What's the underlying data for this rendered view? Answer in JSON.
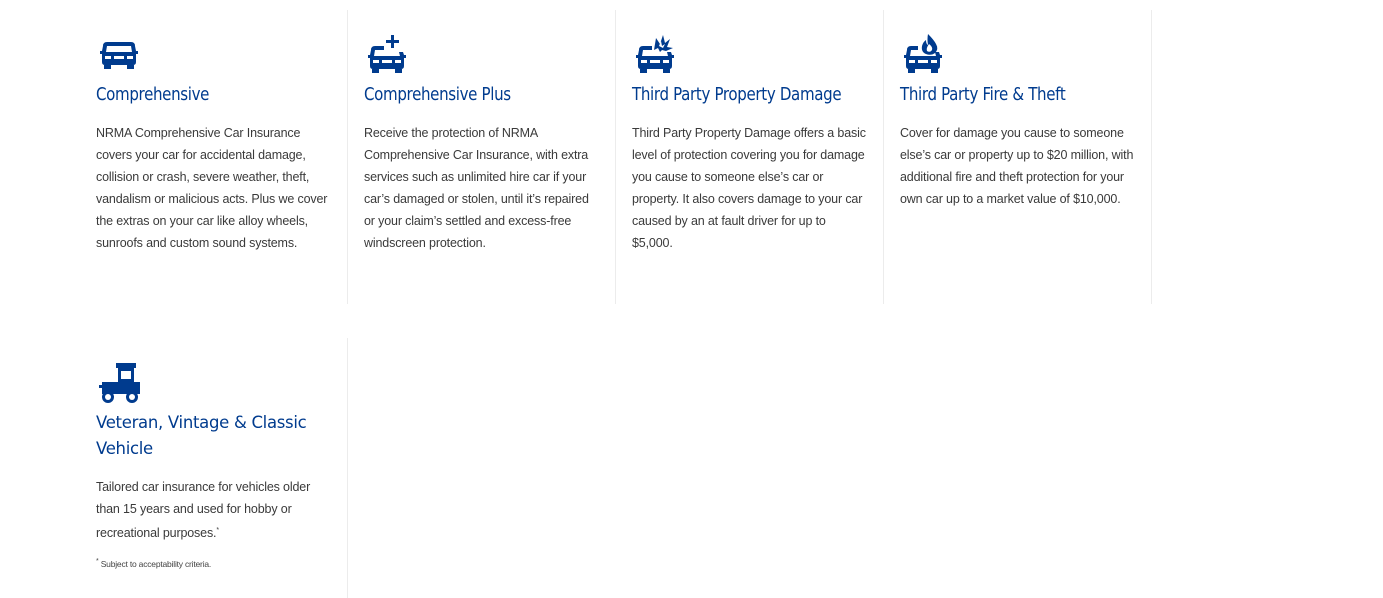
{
  "products": [
    {
      "icon": "car-icon",
      "title": "Comprehensive",
      "description": "NRMA Comprehensive Car Insurance covers your car for accidental damage, collision or crash, severe weather, theft, vandalism or malicious acts. Plus we cover the extras on your car like alloy wheels, sunroofs and custom sound systems."
    },
    {
      "icon": "car-plus-icon",
      "title": "Comprehensive Plus",
      "description": "Receive the protection of NRMA Comprehensive Car Insurance, with extra services such as unlimited hire car if your car’s damaged or stolen, until it’s repaired or your claim’s settled and excess-free windscreen protection."
    },
    {
      "icon": "car-crash-icon",
      "title": "Third Party Property Damage",
      "description": "Third Party Property Damage offers a basic level of protection covering you for damage you cause to someone else’s car or property. It also covers damage to your car caused by an at fault driver for up to $5,000."
    },
    {
      "icon": "car-fire-icon",
      "title": "Third Party Fire & Theft",
      "description": "Cover for damage you cause to someone else’s car or property up to $20 million, with additional fire and theft protection for your own car up to a market value of $10,000."
    },
    {
      "icon": "vintage-car-icon",
      "title": "Veteran, Vintage & Classic Vehicle",
      "description": "Tailored car insurance for vehicles older than 15 years and used for hobby or recreational purposes.",
      "description_marker": "*",
      "footnote_marker": "*",
      "footnote": "Subject to acceptability criteria."
    }
  ],
  "colors": {
    "brand_blue": "#003b8e",
    "body_text": "#3a3a3a",
    "divider": "#ececec"
  }
}
